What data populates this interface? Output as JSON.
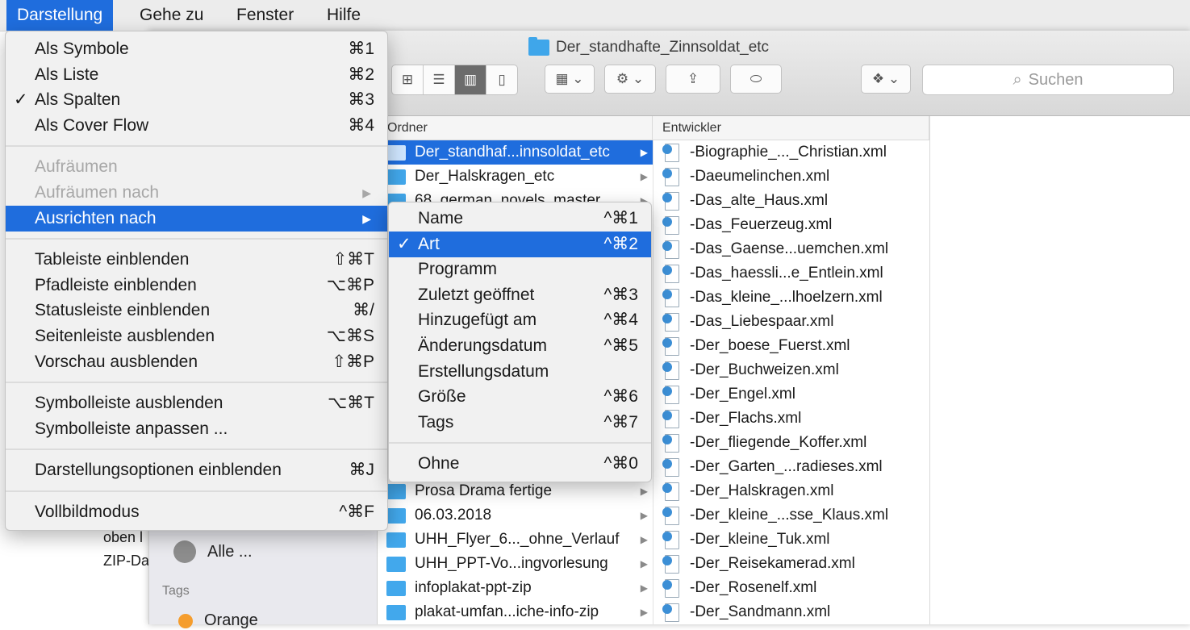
{
  "menubar": [
    "Darstellung",
    "Gehe zu",
    "Fenster",
    "Hilfe"
  ],
  "window": {
    "title": "Der_standhafte_Zinnsoldat_etc",
    "search_placeholder": "Suchen"
  },
  "desktop_text": [
    "oben l",
    "ZIP-Da"
  ],
  "sidebar": {
    "alle": "Alle ...",
    "tags_heading": "Tags",
    "orange": "Orange"
  },
  "columns": {
    "ordner_header": "Ordner",
    "entwickler_header": "Entwickler",
    "ordner": [
      {
        "label": "Der_standhaf...innsoldat_etc",
        "selected": true
      },
      {
        "label": "Der_Halskragen_etc"
      },
      {
        "label": "68_german_novels_master"
      },
      {
        "label": "Prosa Drama fertige"
      },
      {
        "label": "06.03.2018"
      },
      {
        "label": "UHH_Flyer_6..._ohne_Verlauf"
      },
      {
        "label": "UHH_PPT-Vo...ingvorlesung"
      },
      {
        "label": "infoplakat-ppt-zip"
      },
      {
        "label": "plakat-umfan...iche-info-zip"
      }
    ],
    "files": [
      "-Biographie_..._Christian.xml",
      "-Daeumelinchen.xml",
      "-Das_alte_Haus.xml",
      "-Das_Feuerzeug.xml",
      "-Das_Gaense...uemchen.xml",
      "-Das_haessli...e_Entlein.xml",
      "-Das_kleine_...lhoelzern.xml",
      "-Das_Liebespaar.xml",
      "-Der_boese_Fuerst.xml",
      "-Der_Buchweizen.xml",
      "-Der_Engel.xml",
      "-Der_Flachs.xml",
      "-Der_fliegende_Koffer.xml",
      "-Der_Garten_...radieses.xml",
      "-Der_Halskragen.xml",
      "-Der_kleine_...sse_Klaus.xml",
      "-Der_kleine_Tuk.xml",
      "-Der_Reisekamerad.xml",
      "-Der_Rosenelf.xml",
      "-Der_Sandmann.xml"
    ]
  },
  "view_menu": {
    "groups": [
      [
        {
          "label": "Als Symbole",
          "shortcut": "⌘1"
        },
        {
          "label": "Als Liste",
          "shortcut": "⌘2"
        },
        {
          "label": "Als Spalten",
          "shortcut": "⌘3",
          "checked": true
        },
        {
          "label": "Als Cover Flow",
          "shortcut": "⌘4"
        }
      ],
      [
        {
          "label": "Aufräumen",
          "disabled": true
        },
        {
          "label": "Aufräumen nach",
          "disabled": true,
          "submenu": true
        },
        {
          "label": "Ausrichten nach",
          "submenu": true,
          "highlighted": true
        }
      ],
      [
        {
          "label": "Tableiste einblenden",
          "shortcut": "⇧⌘T"
        },
        {
          "label": "Pfadleiste einblenden",
          "shortcut": "⌥⌘P"
        },
        {
          "label": "Statusleiste einblenden",
          "shortcut": "⌘/"
        },
        {
          "label": "Seitenleiste ausblenden",
          "shortcut": "⌥⌘S"
        },
        {
          "label": "Vorschau ausblenden",
          "shortcut": "⇧⌘P"
        }
      ],
      [
        {
          "label": "Symbolleiste ausblenden",
          "shortcut": "⌥⌘T"
        },
        {
          "label": "Symbolleiste anpassen ..."
        }
      ],
      [
        {
          "label": "Darstellungsoptionen einblenden",
          "shortcut": "⌘J"
        }
      ],
      [
        {
          "label": "Vollbildmodus",
          "shortcut": "^⌘F"
        }
      ]
    ]
  },
  "arrange_menu": {
    "groups": [
      [
        {
          "label": "Name",
          "shortcut": "^⌘1"
        },
        {
          "label": "Art",
          "shortcut": "^⌘2",
          "checked": true,
          "highlighted": true
        },
        {
          "label": "Programm"
        },
        {
          "label": "Zuletzt geöffnet",
          "shortcut": "^⌘3"
        },
        {
          "label": "Hinzugefügt am",
          "shortcut": "^⌘4"
        },
        {
          "label": "Änderungsdatum",
          "shortcut": "^⌘5"
        },
        {
          "label": "Erstellungsdatum"
        },
        {
          "label": "Größe",
          "shortcut": "^⌘6"
        },
        {
          "label": "Tags",
          "shortcut": "^⌘7"
        }
      ],
      [
        {
          "label": "Ohne",
          "shortcut": "^⌘0"
        }
      ]
    ]
  }
}
